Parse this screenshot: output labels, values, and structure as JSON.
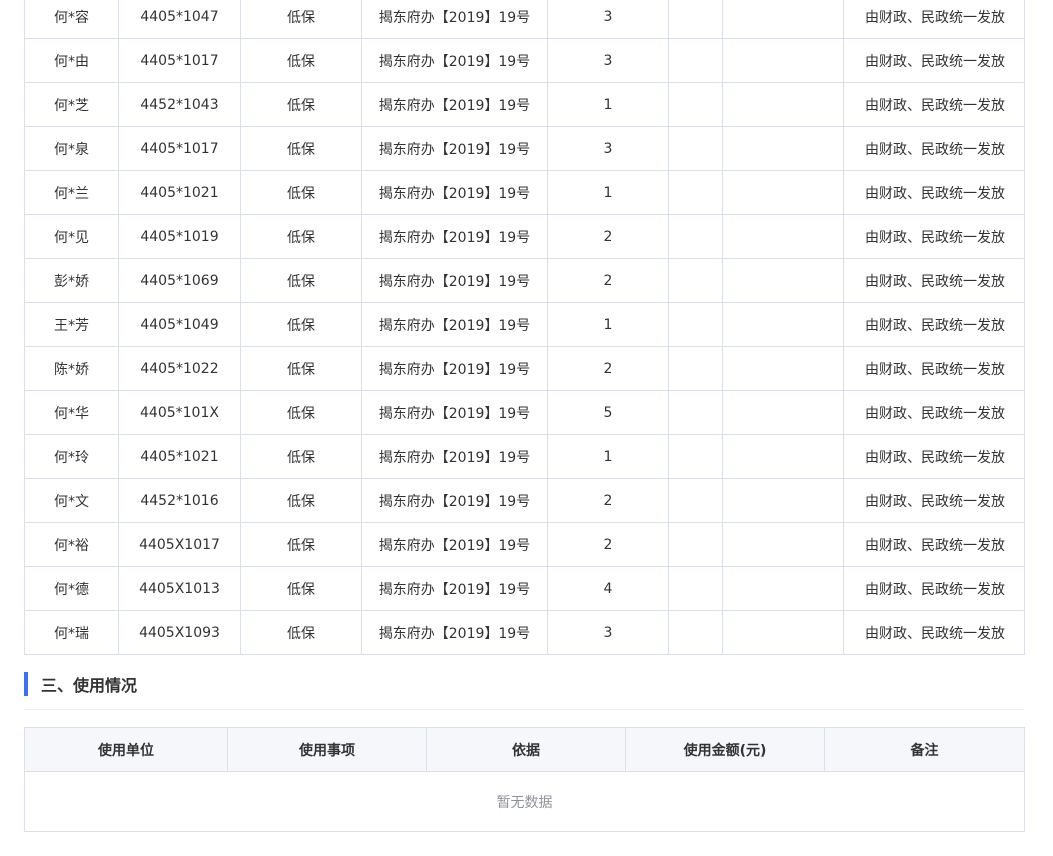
{
  "recipients": {
    "rows": [
      {
        "name": "何*容",
        "id": "4405*1047",
        "type": "低保",
        "basis": "揭东府办【2019】19号",
        "count": "3",
        "col6": "",
        "col7": "",
        "remark": "由财政、民政统一发放"
      },
      {
        "name": "何*由",
        "id": "4405*1017",
        "type": "低保",
        "basis": "揭东府办【2019】19号",
        "count": "3",
        "col6": "",
        "col7": "",
        "remark": "由财政、民政统一发放"
      },
      {
        "name": "何*芝",
        "id": "4452*1043",
        "type": "低保",
        "basis": "揭东府办【2019】19号",
        "count": "1",
        "col6": "",
        "col7": "",
        "remark": "由财政、民政统一发放"
      },
      {
        "name": "何*泉",
        "id": "4405*1017",
        "type": "低保",
        "basis": "揭东府办【2019】19号",
        "count": "3",
        "col6": "",
        "col7": "",
        "remark": "由财政、民政统一发放"
      },
      {
        "name": "何*兰",
        "id": "4405*1021",
        "type": "低保",
        "basis": "揭东府办【2019】19号",
        "count": "1",
        "col6": "",
        "col7": "",
        "remark": "由财政、民政统一发放"
      },
      {
        "name": "何*见",
        "id": "4405*1019",
        "type": "低保",
        "basis": "揭东府办【2019】19号",
        "count": "2",
        "col6": "",
        "col7": "",
        "remark": "由财政、民政统一发放"
      },
      {
        "name": "彭*娇",
        "id": "4405*1069",
        "type": "低保",
        "basis": "揭东府办【2019】19号",
        "count": "2",
        "col6": "",
        "col7": "",
        "remark": "由财政、民政统一发放"
      },
      {
        "name": "王*芳",
        "id": "4405*1049",
        "type": "低保",
        "basis": "揭东府办【2019】19号",
        "count": "1",
        "col6": "",
        "col7": "",
        "remark": "由财政、民政统一发放"
      },
      {
        "name": "陈*娇",
        "id": "4405*1022",
        "type": "低保",
        "basis": "揭东府办【2019】19号",
        "count": "2",
        "col6": "",
        "col7": "",
        "remark": "由财政、民政统一发放"
      },
      {
        "name": "何*华",
        "id": "4405*101X",
        "type": "低保",
        "basis": "揭东府办【2019】19号",
        "count": "5",
        "col6": "",
        "col7": "",
        "remark": "由财政、民政统一发放"
      },
      {
        "name": "何*玲",
        "id": "4405*1021",
        "type": "低保",
        "basis": "揭东府办【2019】19号",
        "count": "1",
        "col6": "",
        "col7": "",
        "remark": "由财政、民政统一发放"
      },
      {
        "name": "何*文",
        "id": "4452*1016",
        "type": "低保",
        "basis": "揭东府办【2019】19号",
        "count": "2",
        "col6": "",
        "col7": "",
        "remark": "由财政、民政统一发放"
      },
      {
        "name": "何*裕",
        "id": "4405X1017",
        "type": "低保",
        "basis": "揭东府办【2019】19号",
        "count": "2",
        "col6": "",
        "col7": "",
        "remark": "由财政、民政统一发放"
      },
      {
        "name": "何*德",
        "id": "4405X1013",
        "type": "低保",
        "basis": "揭东府办【2019】19号",
        "count": "4",
        "col6": "",
        "col7": "",
        "remark": "由财政、民政统一发放"
      },
      {
        "name": "何*瑞",
        "id": "4405X1093",
        "type": "低保",
        "basis": "揭东府办【2019】19号",
        "count": "3",
        "col6": "",
        "col7": "",
        "remark": "由财政、民政统一发放"
      }
    ]
  },
  "usage_section": {
    "title": "三、使用情况",
    "columns": [
      "使用单位",
      "使用事项",
      "依据",
      "使用金额(元)",
      "备注"
    ],
    "empty_text": "暂无数据"
  },
  "colors": {
    "accent": "#3a6ff7",
    "border": "#dcdfe6",
    "header_bg": "#f5f7fa",
    "muted_text": "#909399"
  }
}
